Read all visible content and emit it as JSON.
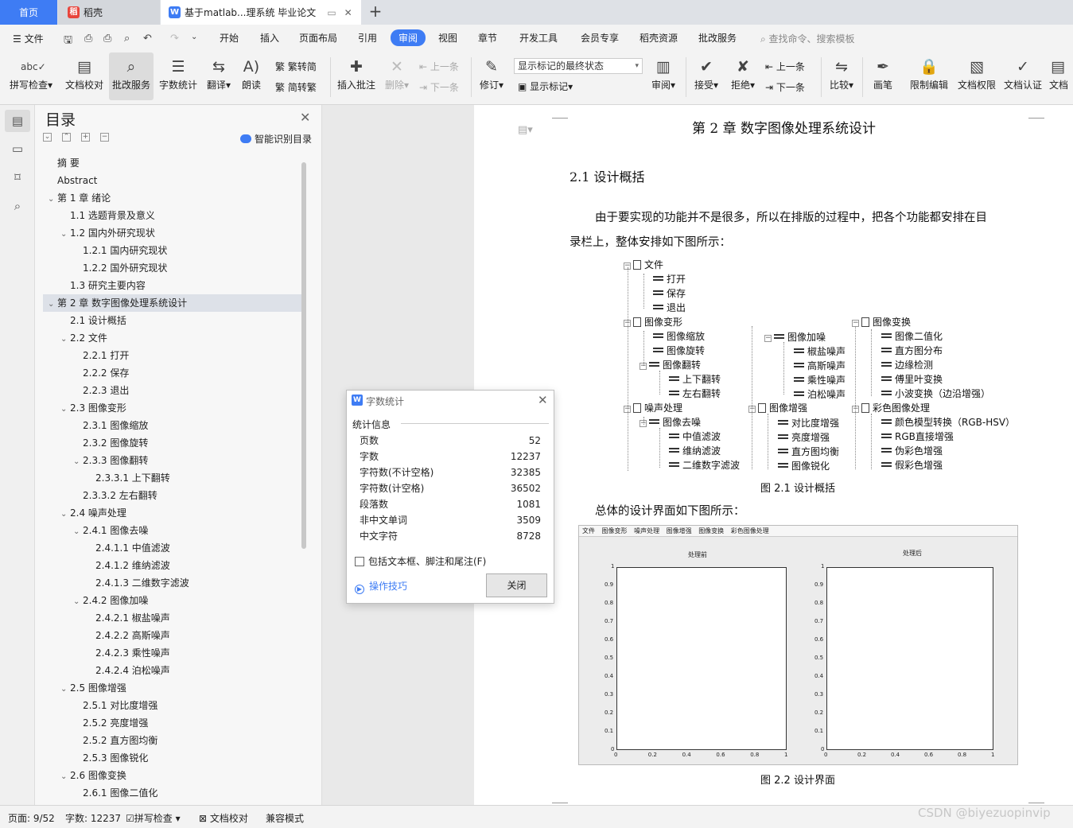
{
  "tabs": {
    "home": "首页",
    "daoke": "稻壳",
    "doc": "基于matlab...理系统 毕业论文"
  },
  "menubar": {
    "file": "文件",
    "tabs": [
      "开始",
      "插入",
      "页面布局",
      "引用",
      "审阅",
      "视图",
      "章节",
      "开发工具",
      "会员专享",
      "稻壳资源",
      "批改服务"
    ],
    "search_placeholder": "查找命令、搜索模板"
  },
  "ribbon": {
    "spell": "拼写检查",
    "proof": "文档校对",
    "correct": "批改服务",
    "wordcount": "字数统计",
    "translate": "翻译",
    "read": "朗读",
    "trad": "繁转简",
    "simp": "简转繁",
    "insert_comment": "插入批注",
    "delete": "删除",
    "prev_c": "上一条",
    "next_c": "下一条",
    "revise": "修订",
    "markup_state": "显示标记的最终状态",
    "show_markup": "显示标记",
    "review": "审阅",
    "accept": "接受",
    "reject": "拒绝",
    "prev": "上一条",
    "next": "下一条",
    "compare": "比较",
    "pen": "画笔",
    "restrict": "限制编辑",
    "rights": "文档权限",
    "auth": "文档认证",
    "more": "文档"
  },
  "toc": {
    "title": "目录",
    "smart": "智能识别目录",
    "items": [
      {
        "label": "摘    要",
        "level": 0
      },
      {
        "label": "Abstract",
        "level": 0
      },
      {
        "label": "第 1 章  绪论",
        "level": 0,
        "caret": true
      },
      {
        "label": "1.1 选题背景及意义",
        "level": 1
      },
      {
        "label": "1.2 国内外研究现状",
        "level": 1,
        "caret": true
      },
      {
        "label": "1.2.1 国内研究现状",
        "level": 2
      },
      {
        "label": "1.2.2 国外研究现状",
        "level": 2
      },
      {
        "label": "1.3 研究主要内容",
        "level": 1
      },
      {
        "label": "第 2 章  数字图像处理系统设计",
        "level": 0,
        "caret": true,
        "active": true
      },
      {
        "label": "2.1 设计概括",
        "level": 1
      },
      {
        "label": "2.2 文件",
        "level": 1,
        "caret": true
      },
      {
        "label": "2.2.1 打开",
        "level": 2
      },
      {
        "label": "2.2.2 保存",
        "level": 2
      },
      {
        "label": "2.2.3 退出",
        "level": 2
      },
      {
        "label": "2.3 图像变形",
        "level": 1,
        "caret": true
      },
      {
        "label": "2.3.1 图像缩放",
        "level": 2
      },
      {
        "label": "2.3.2 图像旋转",
        "level": 2
      },
      {
        "label": "2.3.3 图像翻转",
        "level": 2,
        "caret": true
      },
      {
        "label": "2.3.3.1 上下翻转",
        "level": 3
      },
      {
        "label": "2.3.3.2 左右翻转",
        "level": 2
      },
      {
        "label": "2.4 噪声处理",
        "level": 1,
        "caret": true
      },
      {
        "label": "2.4.1 图像去噪",
        "level": 2,
        "caret": true
      },
      {
        "label": "2.4.1.1 中值滤波",
        "level": 3
      },
      {
        "label": "2.4.1.2 维纳滤波",
        "level": 3
      },
      {
        "label": "2.4.1.3 二维数字滤波",
        "level": 3
      },
      {
        "label": "2.4.2 图像加噪",
        "level": 2,
        "caret": true
      },
      {
        "label": "2.4.2.1 椒盐噪声",
        "level": 3
      },
      {
        "label": "2.4.2.2 高斯噪声",
        "level": 3
      },
      {
        "label": "2.4.2.3 乘性噪声",
        "level": 3
      },
      {
        "label": "2.4.2.4 泊松噪声",
        "level": 3
      },
      {
        "label": "2.5 图像增强",
        "level": 1,
        "caret": true
      },
      {
        "label": "2.5.1 对比度增强",
        "level": 2
      },
      {
        "label": "2.5.2 亮度增强",
        "level": 2
      },
      {
        "label": "2.5.2 直方图均衡",
        "level": 2
      },
      {
        "label": "2.5.3 图像锐化",
        "level": 2
      },
      {
        "label": "2.6 图像变换",
        "level": 1,
        "caret": true
      },
      {
        "label": "2.6.1 图像二值化",
        "level": 2
      }
    ]
  },
  "doc": {
    "chapter": "第 2 章  数字图像处理系统设计",
    "section": "2.1 设计概括",
    "para1a": "由于要实现的功能并不是很多，所以在排版的过程中，把各个功能都安排在目",
    "para1b": "录栏上，整体安排如下图所示：",
    "fig1_caption": "图 2.1  设计概括",
    "para2": "总体的设计界面如下图所示：",
    "fig2_caption": "图 2.2  设计界面",
    "tree": {
      "file": "文件",
      "open": "打开",
      "save": "保存",
      "exit": "退出",
      "deform": "图像变形",
      "scale": "图像缩放",
      "rotate": "图像旋转",
      "flip": "图像翻转",
      "flip_ud": "上下翻转",
      "flip_lr": "左右翻转",
      "noise": "噪声处理",
      "denoise": "图像去噪",
      "median": "中值滤波",
      "wiener": "维纳滤波",
      "filter2": "二维数字滤波",
      "addnoise": "图像加噪",
      "salt": "椒盐噪声",
      "gauss": "高斯噪声",
      "mult": "乘性噪声",
      "poisson": "泊松噪声",
      "enhance": "图像增强",
      "contrast": "对比度增强",
      "bright": "亮度增强",
      "histeq": "直方图均衡",
      "sharpen": "图像锐化",
      "transform": "图像变换",
      "binary": "图像二值化",
      "hist": "直方图分布",
      "edge": "边缘检测",
      "fourier": "傅里叶变换",
      "wavelet": "小波变换（边沿增强）",
      "color": "彩色图像处理",
      "rgbhsv": "颜色模型转换（RGB-HSV）",
      "rgbenh": "RGB直接增强",
      "pseudo": "伪彩色增强",
      "fake": "假彩色增强"
    },
    "figure": {
      "menu": [
        "文件",
        "图像变形",
        "噪声处理",
        "图像增强",
        "图像变换",
        "彩色图像处理"
      ],
      "before": "处理前",
      "after": "处理后",
      "yticks": [
        "0",
        "0.1",
        "0.2",
        "0.3",
        "0.4",
        "0.5",
        "0.6",
        "0.7",
        "0.8",
        "0.9",
        "1"
      ],
      "xticks": [
        "0",
        "0.2",
        "0.4",
        "0.6",
        "0.8",
        "1"
      ]
    }
  },
  "dialog": {
    "title": "字数统计",
    "group": "统计信息",
    "rows": [
      {
        "label": "页数",
        "value": "52"
      },
      {
        "label": "字数",
        "value": "12237"
      },
      {
        "label": "字符数(不计空格)",
        "value": "32385"
      },
      {
        "label": "字符数(计空格)",
        "value": "36502"
      },
      {
        "label": "段落数",
        "value": "1081"
      },
      {
        "label": "非中文单词",
        "value": "3509"
      },
      {
        "label": "中文字符",
        "value": "8728"
      }
    ],
    "checkbox": "包括文本框、脚注和尾注(F)",
    "tips": "操作技巧",
    "close": "关闭"
  },
  "status": {
    "page": "页面: 9/52",
    "words": "字数: 12237",
    "spell": "拼写检查",
    "proof": "文档校对",
    "compat": "兼容模式"
  },
  "watermark": "CSDN @biyezuopinvip",
  "colors": {
    "accent": "#3e7cf4"
  }
}
